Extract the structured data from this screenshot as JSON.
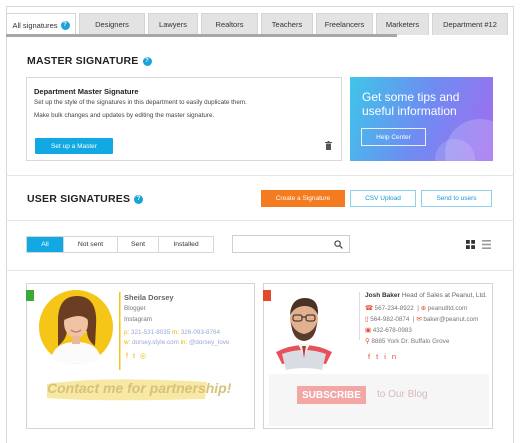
{
  "tabs": [
    {
      "label": "All signatures",
      "badge": "?",
      "active": true
    },
    {
      "label": "Designers"
    },
    {
      "label": "Lawyers"
    },
    {
      "label": "Realtors"
    },
    {
      "label": "Teachers"
    },
    {
      "label": "Freelancers"
    },
    {
      "label": "Marketers"
    },
    {
      "label": "Department #12"
    }
  ],
  "master": {
    "title": "MASTER SIGNATURE",
    "info": "?",
    "card_title": "Department Master Signature",
    "desc1": "Set up the style of the signatures in this department to easily duplicate them.",
    "desc2": "Make bulk changes and updates by editing the master signature.",
    "setup_button": "Set up a Master"
  },
  "tips": {
    "line1": "Get some tips and",
    "line2": "useful information",
    "button": "Help Center"
  },
  "user_signatures": {
    "title": "USER SIGNATURES",
    "info": "?",
    "create_button": "Create a Signature",
    "csv_button": "CSV Upload",
    "send_button": "Send to users"
  },
  "filters": [
    "All",
    "Not sent",
    "Sent",
    "Installed"
  ],
  "search": {
    "placeholder": ""
  },
  "colors": {
    "accent": "#11a8e4",
    "orange": "#f47b20",
    "green_flag": "#3aa935",
    "red_flag": "#e5492b"
  },
  "sig1": {
    "name": "Sheila Dorsey",
    "role": "Blogger",
    "company": "Instagram",
    "phone1": "321-531-8035",
    "phone2": "326-093-8764",
    "site": "dorsey.style.com",
    "handle": "@dorsey_love",
    "banner": "Contact me for partnership!"
  },
  "sig2": {
    "name": "Josh Baker",
    "title": "Head of Sales at Peanut, Ltd.",
    "phone1": "567-234-8922",
    "phone2": "564-982-0874",
    "fax": "432-678-0983",
    "web": "peanutltd.com",
    "email": "baker@peanut.com",
    "address": "8885 York Dr. Buffalo Grove",
    "subscribe": "SUBSCRIBE",
    "blog": "to Our Blog"
  }
}
